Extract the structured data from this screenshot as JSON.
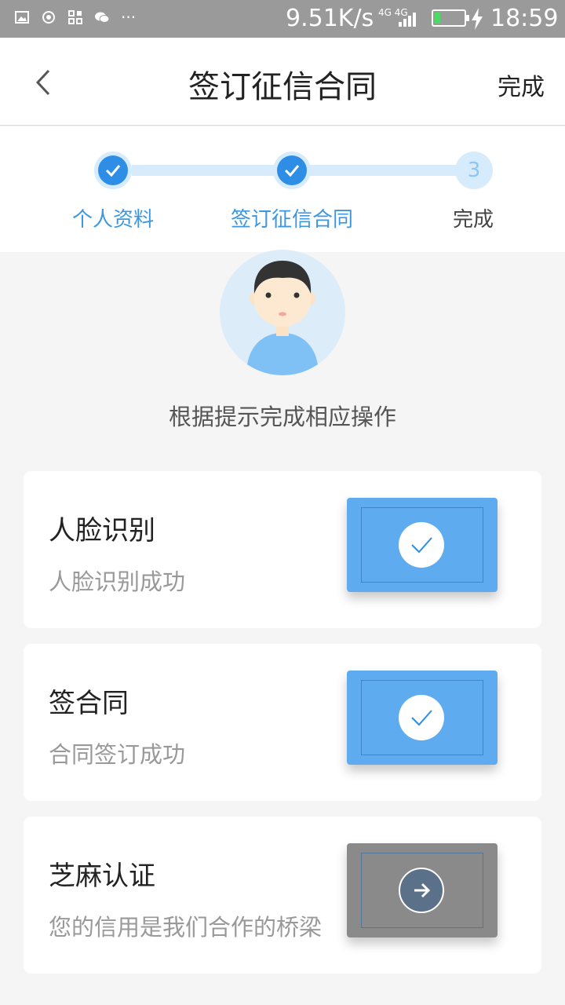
{
  "status_bar": {
    "speed": "9.51K/s",
    "network": "4G 4G",
    "time": "18:59",
    "icons": [
      "image-icon",
      "eye-icon",
      "apps-icon",
      "wechat-icon",
      "more-dots-icon",
      "signal-icon",
      "battery-icon",
      "charging-icon"
    ]
  },
  "header": {
    "title": "签订征信合同",
    "done_label": "完成",
    "back_icon": "chevron-left-icon"
  },
  "steps": [
    {
      "label": "个人资料",
      "state": "done"
    },
    {
      "label": "签订征信合同",
      "state": "done"
    },
    {
      "label": "完成",
      "state": "pending",
      "number": "3"
    }
  ],
  "instruction": "根据提示完成相应操作",
  "cards": [
    {
      "title": "人脸识别",
      "subtitle": "人脸识别成功",
      "status": "success",
      "icon": "check-icon"
    },
    {
      "title": "签合同",
      "subtitle": "合同签订成功",
      "status": "success",
      "icon": "check-icon"
    },
    {
      "title": "芝麻认证",
      "subtitle": "您的信用是我们合作的桥梁",
      "status": "pending",
      "icon": "arrow-right-icon"
    }
  ],
  "colors": {
    "accent": "#2e8ee6",
    "step_track": "#d6ebfb",
    "card_blue": "#5eacef",
    "card_gray": "#8a8a8a",
    "background": "#f5f5f5"
  }
}
